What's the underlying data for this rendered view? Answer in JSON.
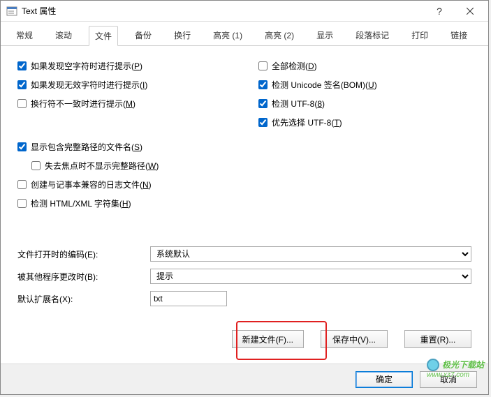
{
  "title": "Text 属性",
  "tabs": [
    "常规",
    "滚动",
    "文件",
    "备份",
    "换行",
    "高亮 (1)",
    "高亮 (2)",
    "显示",
    "段落标记",
    "打印",
    "链接"
  ],
  "active_tab_index": 2,
  "left_checks": [
    {
      "label": "如果发现空字符时进行提示(P)",
      "checked": true
    },
    {
      "label": "如果发现无效字符时进行提示(I)",
      "checked": true
    },
    {
      "label": "换行符不一致时进行提示(M)",
      "checked": false
    }
  ],
  "right_checks": [
    {
      "label": "全部检测(D)",
      "checked": false
    },
    {
      "label": "检测 Unicode 签名(BOM)(U)",
      "checked": true
    },
    {
      "label": "检测 UTF-8(8)",
      "checked": true
    },
    {
      "label": "优先选择 UTF-8(T)",
      "checked": true
    }
  ],
  "lower_checks": [
    {
      "label": "显示包含完整路径的文件名(S)",
      "checked": true,
      "indent": false
    },
    {
      "label": "失去焦点时不显示完整路径(W)",
      "checked": false,
      "indent": true
    },
    {
      "label": "创建与记事本兼容的日志文件(N)",
      "checked": false,
      "indent": false
    },
    {
      "label": "检测 HTML/XML 字符集(H)",
      "checked": false,
      "indent": false
    }
  ],
  "form": {
    "encoding_label": "文件打开时的编码(E):",
    "encoding_value": "系统默认",
    "modified_label": "被其他程序更改时(B):",
    "modified_value": "提示",
    "ext_label": "默认扩展名(X):",
    "ext_value": "txt"
  },
  "buttons": {
    "new_file": "新建文件(F)...",
    "saving": "保存中(V)...",
    "reset": "重置(R)..."
  },
  "footer": {
    "ok": "确定",
    "cancel": "取消"
  },
  "watermark": {
    "main": "极光下载站",
    "sub": "www.xz7.com"
  }
}
